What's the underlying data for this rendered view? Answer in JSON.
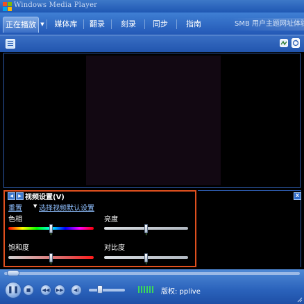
{
  "window": {
    "title": "Windows Media Player"
  },
  "tabs": [
    {
      "label": "正在播放",
      "active": true
    },
    {
      "label": "媒体库"
    },
    {
      "label": "翻录"
    },
    {
      "label": "刻录"
    },
    {
      "label": "同步"
    },
    {
      "label": "指南"
    }
  ],
  "promo_text": "SMB 用户主题网址体验",
  "settings": {
    "title": "视频设置(V)",
    "reset": "重置",
    "select_default": "选择视频默认设置",
    "sliders": [
      {
        "label": "色相",
        "value": 0.5
      },
      {
        "label": "亮度",
        "value": 0.5
      },
      {
        "label": "饱和度",
        "value": 0.5
      },
      {
        "label": "对比度",
        "value": 0.5
      }
    ]
  },
  "status": "版权: pplive",
  "seek_value": 0.0,
  "volume_value": 0.15,
  "icons": {
    "quick_menu": "menu-icon",
    "shuffle": "shuffle-icon",
    "repeat": "repeat-icon",
    "prev_setting": "arrow-left-icon",
    "next_setting": "arrow-right-icon",
    "close": "close-icon",
    "play": "pause-icon",
    "stop": "stop-icon",
    "previous": "previous-icon",
    "next": "next-icon",
    "mute": "speaker-icon"
  },
  "colors": {
    "accent": "#e0501e",
    "chrome": "#2c5fb5",
    "link": "#8fbfff"
  }
}
